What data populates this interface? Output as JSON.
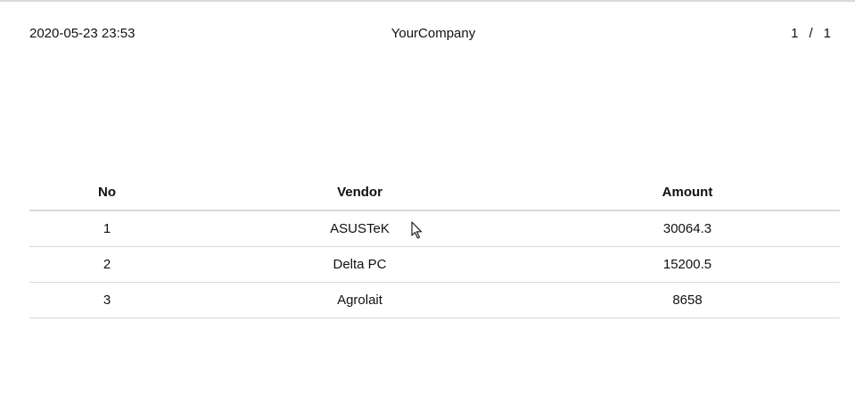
{
  "header": {
    "datetime": "2020-05-23 23:53",
    "company": "YourCompany",
    "page_current": "1",
    "page_separator": "/",
    "page_total": "1"
  },
  "table": {
    "columns": [
      "No",
      "Vendor",
      "Amount"
    ],
    "rows": [
      {
        "no": "1",
        "vendor": "ASUSTeK",
        "amount": "30064.3"
      },
      {
        "no": "2",
        "vendor": "Delta PC",
        "amount": "15200.5"
      },
      {
        "no": "3",
        "vendor": "Agrolait",
        "amount": "8658"
      }
    ]
  },
  "icons": {
    "cursor": "mouse-pointer-icon"
  },
  "colors": {
    "rule": "#d9d9d9",
    "text": "#111111"
  }
}
